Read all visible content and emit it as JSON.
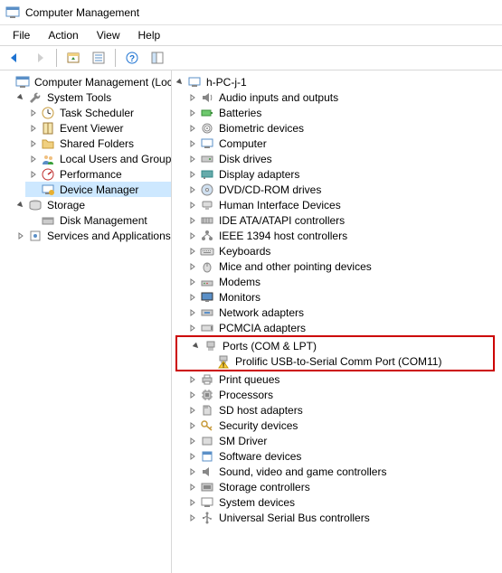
{
  "window": {
    "title": "Computer Management"
  },
  "menu": {
    "file": "File",
    "action": "Action",
    "view": "View",
    "help": "Help"
  },
  "left": {
    "root": "Computer Management (Local",
    "systools": "System Tools",
    "tasksched": "Task Scheduler",
    "eventviewer": "Event Viewer",
    "sharedfolders": "Shared Folders",
    "localusers": "Local Users and Groups",
    "performance": "Performance",
    "devmgr": "Device Manager",
    "storage": "Storage",
    "diskmgmt": "Disk Management",
    "services": "Services and Applications"
  },
  "right": {
    "root": "h-PC-j-1",
    "audio": "Audio inputs and outputs",
    "batteries": "Batteries",
    "biometric": "Biometric devices",
    "computer": "Computer",
    "diskdrives": "Disk drives",
    "display": "Display adapters",
    "dvd": "DVD/CD-ROM drives",
    "hid": "Human Interface Devices",
    "ide": "IDE ATA/ATAPI controllers",
    "ieee1394": "IEEE 1394 host controllers",
    "keyboards": "Keyboards",
    "mice": "Mice and other pointing devices",
    "modems": "Modems",
    "monitors": "Monitors",
    "network": "Network adapters",
    "pcmcia": "PCMCIA adapters",
    "ports": "Ports (COM & LPT)",
    "prolific": "Prolific USB-to-Serial Comm Port (COM11)",
    "printqueues": "Print queues",
    "processors": "Processors",
    "sdhost": "SD host adapters",
    "security": "Security devices",
    "smdriver": "SM Driver",
    "software": "Software devices",
    "sound": "Sound, video and game controllers",
    "storagectl": "Storage controllers",
    "sysdevices": "System devices",
    "usb": "Universal Serial Bus controllers"
  }
}
